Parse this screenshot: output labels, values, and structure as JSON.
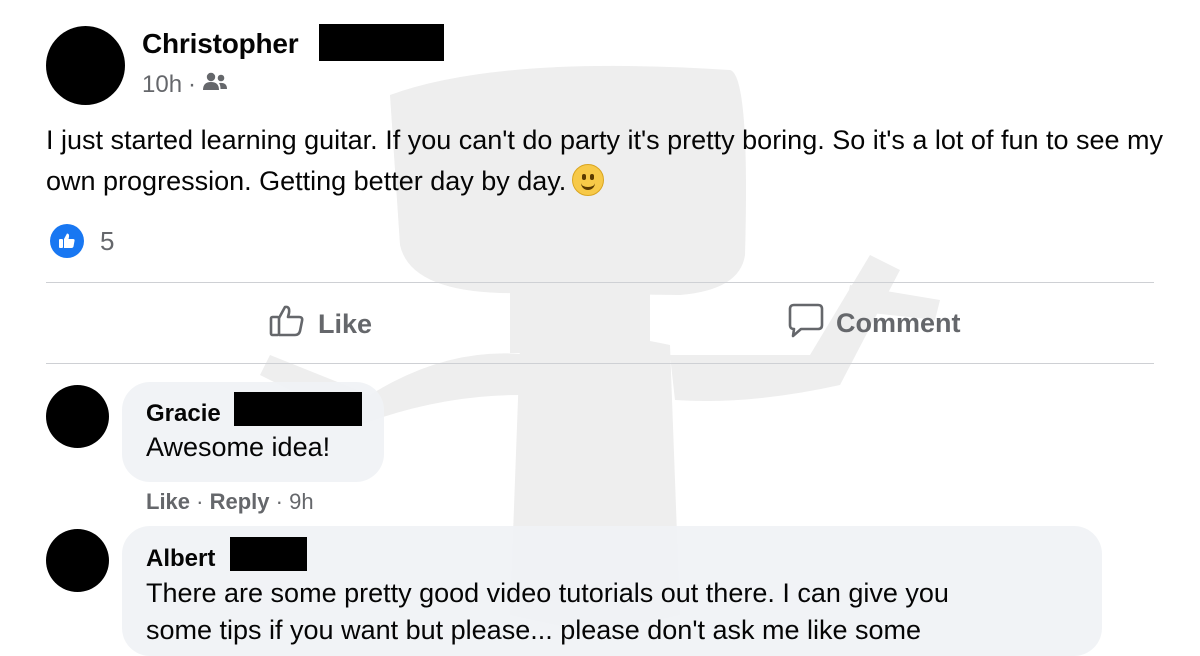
{
  "post": {
    "author": "Christopher",
    "time": "10h",
    "separator": "·",
    "audience_icon": "friends-icon",
    "text": "I just started learning guitar. If you can't do party it's pretty boring. So it's a lot of fun to see my own progression. Getting better day by day.",
    "emoji": "slightly-smiling-face",
    "reaction_icon": "like-badge-icon",
    "reaction_count": "5"
  },
  "actions": {
    "like_label": "Like",
    "comment_label": "Comment"
  },
  "comments": [
    {
      "author": "Gracie",
      "text": "Awesome idea!",
      "like_label": "Like",
      "reply_label": "Reply",
      "time": "9h",
      "separator": "·"
    },
    {
      "author": "Albert",
      "text": "There are some pretty good video tutorials out there. I can give you",
      "text_cont": "some tips if you want but please... please don't ask me like some"
    }
  ],
  "colors": {
    "text": "#050505",
    "secondary": "#65676b",
    "accent": "#1877f2",
    "bubble": "#f0f2f5",
    "divider": "#ced0d4"
  }
}
